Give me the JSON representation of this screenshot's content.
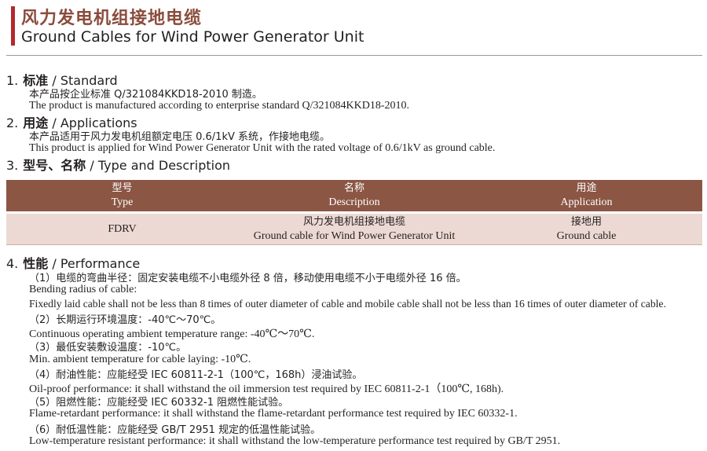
{
  "header": {
    "title_cn": "风力发电机组接地电缆",
    "title_en": "Ground Cables for Wind Power Generator Unit"
  },
  "sections": {
    "standard": {
      "num": "1.",
      "cn": "标准",
      "en": "/ Standard",
      "line_cn": "本产品按企业标准 Q/321084KKD18-2010 制造。",
      "line_en": "The product is manufactured according to enterprise standard Q/321084KKD18-2010."
    },
    "applications": {
      "num": "2.",
      "cn": "用途",
      "en": "/ Applications",
      "line_cn": "本产品适用于风力发电机组额定电压 0.6/1kV 系统，作接地电缆。",
      "line_en": "This product is applied for Wind Power Generator Unit with the rated voltage of 0.6/1kV as ground cable."
    },
    "type": {
      "num": "3.",
      "cn": "型号、名称",
      "en": "/ Type and Description"
    },
    "performance": {
      "num": "4.",
      "cn": "性能",
      "en": "/ Performance",
      "lines": [
        "（1）电缆的弯曲半径：固定安装电缆不小电缆外径 8 倍，移动使用电缆不小于电缆外径 16 倍。",
        "Bending radius of cable:",
        "Fixedly laid cable shall not be less than 8 times of outer diameter of cable and mobile cable shall not be less than 16 times of outer diameter of cable.",
        "（2）长期运行环境温度：-40℃～70℃。",
        "Continuous operating ambient temperature range: -40℃～70℃.",
        "（3）最低安装敷设温度：-10℃。",
        "Min. ambient temperature for cable laying: -10℃.",
        "（4）耐油性能：应能经受 IEC 60811-2-1（100℃，168h）浸油试验。",
        "Oil-proof performance: it shall withstand the oil immersion test required by IEC 60811-2-1（100℃, 168h).",
        "（5）阻燃性能：应能经受 IEC 60332-1 阻燃性能试验。",
        "Flame-retardant performance: it shall withstand the flame-retardant performance test required by IEC 60332-1.",
        "（6）耐低温性能：应能经受 GB/T 2951 规定的低温性能试验。",
        "Low-temperature resistant performance: it shall withstand the low-temperature performance test required by GB/T 2951."
      ]
    }
  },
  "table": {
    "headers": [
      {
        "cn": "型号",
        "en": "Type"
      },
      {
        "cn": "名称",
        "en": "Description"
      },
      {
        "cn": "用途",
        "en": "Application"
      }
    ],
    "row": {
      "type": "FDRV",
      "desc_cn": "风力发电机组接地电缆",
      "desc_en": "Ground cable for Wind Power Generator Unit",
      "app_cn": "接地用",
      "app_en": "Ground cable"
    }
  },
  "colors": {
    "accent_bar": "#b5272d",
    "title_brown": "#8a4c3c",
    "table_header": "#8b5644",
    "table_row": "#ecd9d3"
  }
}
